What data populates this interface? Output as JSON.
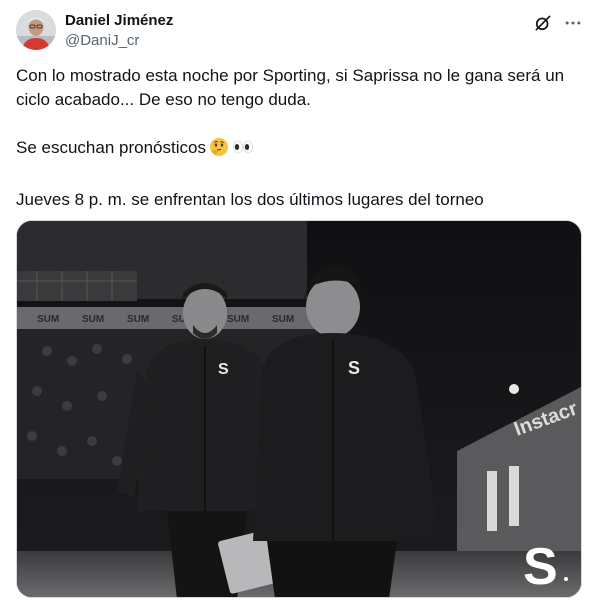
{
  "author": {
    "display_name": "Daniel Jiménez",
    "handle": "@DaniJ_cr"
  },
  "actions": {
    "grok_icon": "grok-slash-icon",
    "more_icon": "more-horizontal-icon"
  },
  "tweet": {
    "line1": "Con lo mostrado esta noche por Sporting, si Saprissa no le gana será un ciclo acabado... De eso no tengo duda.",
    "line2": "Se escuchan pronósticos",
    "line2_emojis": [
      "thinking-face",
      "eyes"
    ],
    "line3": "Jueves 8 p. m. se enfrentan los dos últimos lugares del torneo"
  },
  "media": {
    "description_icon": "saprissa-s-logo",
    "watermark_letter": "S"
  },
  "colors": {
    "text_primary": "#0f1419",
    "text_secondary": "#536471",
    "border": "#cfd9de"
  }
}
